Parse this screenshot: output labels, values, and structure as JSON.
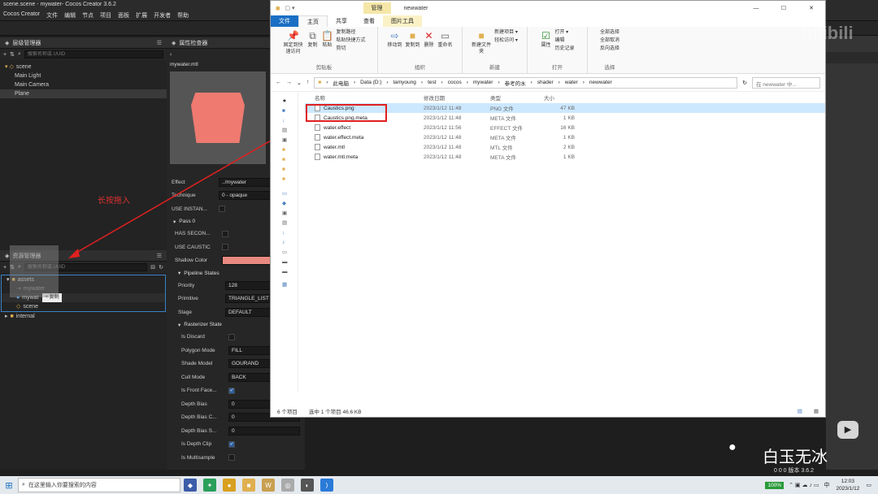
{
  "cocos": {
    "title": "scene.scene - mywater- Cocos Creator 3.6.2",
    "menu": [
      "Cocos Creator",
      "文件",
      "编辑",
      "节点",
      "项目",
      "面板",
      "扩展",
      "开发者",
      "帮助"
    ],
    "hierarchy": {
      "title": "层级管理器",
      "search_placeholder": "搜索名称或 UUID",
      "nodes": [
        "scene",
        "Main Light",
        "Main Camera",
        "Plane"
      ]
    },
    "inspector": {
      "title": "属性检查器",
      "asset_name": "mywater.mtl",
      "props": [
        {
          "label": "Effect",
          "value": "../mywater"
        },
        {
          "label": "Technique",
          "value": "0 - opaque"
        },
        {
          "label": "USE INSTAN...",
          "value": ""
        }
      ],
      "pass_label": "Pass 0",
      "pass_props": [
        {
          "label": "HAS SECON...",
          "value": ""
        },
        {
          "label": "USE CAUSTIC",
          "value": ""
        },
        {
          "label": "Shallow Color",
          "value": ""
        }
      ],
      "pipeline_label": "Pipeline States",
      "pipeline_props": [
        {
          "label": "Priority",
          "value": "128"
        },
        {
          "label": "Primitive",
          "value": "TRIANGLE_LIST"
        },
        {
          "label": "Stage",
          "value": "DEFAULT"
        }
      ],
      "raster_label": "Rasterizer State",
      "raster_props": [
        {
          "label": "Is Discard",
          "value": ""
        },
        {
          "label": "Polygon Mode",
          "value": "FILL"
        },
        {
          "label": "Shade Model",
          "value": "GOURAND"
        },
        {
          "label": "Cull Mode",
          "value": "BACK"
        },
        {
          "label": "Is Front Face...",
          "value": ""
        },
        {
          "label": "Depth Bias",
          "value": "0"
        },
        {
          "label": "Depth Bias C...",
          "value": "0"
        },
        {
          "label": "Depth Bias S...",
          "value": "0"
        },
        {
          "label": "Is Depth Clip",
          "value": ""
        },
        {
          "label": "Is Multisample",
          "value": ""
        }
      ]
    },
    "assets": {
      "title": "资源管理器",
      "search_placeholder": "搜索名称或 UUID",
      "items": [
        "assets",
        "mywater",
        "mywat",
        "scene",
        "internal"
      ],
      "copy_tooltip": "+ 复制"
    },
    "annotation": "长按拖入",
    "swatch_color": "#e88a80",
    "preview_color": "#ee7a70"
  },
  "explorer": {
    "tab_manage": "管理",
    "window_title": "newwater",
    "tabs": [
      "文件",
      "主页",
      "共享",
      "查看",
      "图片工具"
    ],
    "ribbon": {
      "pin": "固定到快速访问",
      "copy": "复制",
      "paste": "粘贴",
      "copy_path": "复制路径",
      "paste_shortcut": "粘贴快捷方式",
      "cut": "剪切",
      "clipboard": "剪贴板",
      "move_to": "移动到",
      "copy_to": "复制到",
      "delete": "删除",
      "rename": "重命名",
      "organize": "组织",
      "new_folder": "新建文件夹",
      "new_item": "新建项目 ▾",
      "easy_access": "轻松访问 ▾",
      "new": "新建",
      "properties": "属性",
      "open": "打开 ▾",
      "edit": "编辑",
      "history": "历史记录",
      "open_group": "打开",
      "select_all": "全部选择",
      "select_none": "全部取消",
      "invert": "反向选择",
      "select_group": "选择"
    },
    "path": [
      "此电脑",
      "Data (D:)",
      "lamyoung",
      "test",
      "cocos",
      "mywater",
      "参考的水",
      "shader",
      "water",
      "newwater"
    ],
    "search_placeholder": "在 newwater 中...",
    "columns": [
      "名称",
      "修改日期",
      "类型",
      "大小"
    ],
    "files": [
      {
        "name": "Caustics.png",
        "date": "2023/1/12 11:48",
        "type": "PNG 文件",
        "size": "47 KB"
      },
      {
        "name": "Caustics.png.meta",
        "date": "2023/1/12 11:48",
        "type": "META 文件",
        "size": "1 KB"
      },
      {
        "name": "water.effect",
        "date": "2023/1/12 11:56",
        "type": "EFFECT 文件",
        "size": "16 KB"
      },
      {
        "name": "water.effect.meta",
        "date": "2023/1/12 11:48",
        "type": "META 文件",
        "size": "1 KB"
      },
      {
        "name": "water.mtl",
        "date": "2023/1/12 11:48",
        "type": "MTL 文件",
        "size": "2 KB"
      },
      {
        "name": "water.mtl.meta",
        "date": "2023/1/12 11:48",
        "type": "META 文件",
        "size": "1 KB"
      }
    ],
    "status_count": "6 个项目",
    "status_selected": "选中 1 个项目  46.6 KB"
  },
  "watermark": {
    "name": "白玉无冰",
    "logo": "bilibili"
  },
  "right_panel": {
    "stats": "0  0  0  版本 3.6.2"
  },
  "taskbar": {
    "search_placeholder": "在这里输入你要搜索的内容",
    "battery": "100%",
    "ime": "中",
    "time": "12:03",
    "date": "2023/1/12"
  }
}
